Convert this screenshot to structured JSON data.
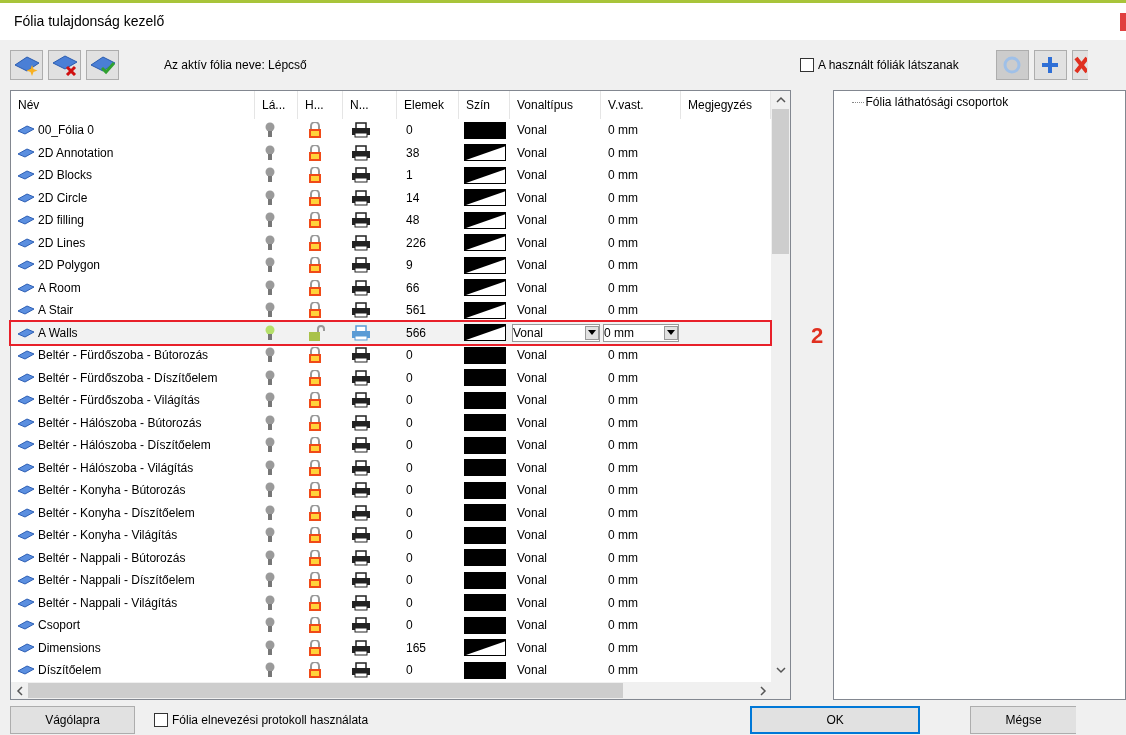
{
  "window": {
    "title": "Fólia tulajdonság kezelő"
  },
  "toolbar": {
    "active_layer_label": "Az aktív fólia neve: Lépcső"
  },
  "table": {
    "columns": [
      "Név",
      "Lá...",
      "H...",
      "N...",
      "Elemek",
      "Szín",
      "Vonaltípus",
      "V.vast.",
      "Megjegyzés"
    ],
    "rows": [
      {
        "name": "00_Fólia 0",
        "elements": "0",
        "kind": "solid",
        "linetype": "Vonal",
        "width": "0 mm",
        "selected": false
      },
      {
        "name": "2D Annotation",
        "elements": "38",
        "kind": "gradient",
        "linetype": "Vonal",
        "width": "0 mm",
        "selected": false
      },
      {
        "name": "2D Blocks",
        "elements": "1",
        "kind": "gradient",
        "linetype": "Vonal",
        "width": "0 mm",
        "selected": false
      },
      {
        "name": "2D Circle",
        "elements": "14",
        "kind": "gradient",
        "linetype": "Vonal",
        "width": "0 mm",
        "selected": false
      },
      {
        "name": "2D filling",
        "elements": "48",
        "kind": "gradient",
        "linetype": "Vonal",
        "width": "0 mm",
        "selected": false
      },
      {
        "name": "2D Lines",
        "elements": "226",
        "kind": "gradient",
        "linetype": "Vonal",
        "width": "0 mm",
        "selected": false
      },
      {
        "name": "2D Polygon",
        "elements": "9",
        "kind": "gradient",
        "linetype": "Vonal",
        "width": "0 mm",
        "selected": false
      },
      {
        "name": "A Room",
        "elements": "66",
        "kind": "gradient",
        "linetype": "Vonal",
        "width": "0 mm",
        "selected": false
      },
      {
        "name": "A Stair",
        "elements": "561",
        "kind": "gradient",
        "linetype": "Vonal",
        "width": "0 mm",
        "selected": false
      },
      {
        "name": "A Walls",
        "elements": "566",
        "kind": "gradient",
        "linetype": "Vonal",
        "width": "0 mm",
        "selected": true
      },
      {
        "name": "Beltér - Fürdőszoba - Bútorozás",
        "elements": "0",
        "kind": "solid",
        "linetype": "Vonal",
        "width": "0 mm",
        "selected": false
      },
      {
        "name": "Beltér - Fürdőszoba - Díszítőelem",
        "elements": "0",
        "kind": "solid",
        "linetype": "Vonal",
        "width": "0 mm",
        "selected": false
      },
      {
        "name": "Beltér - Fürdőszoba - Világítás",
        "elements": "0",
        "kind": "solid",
        "linetype": "Vonal",
        "width": "0 mm",
        "selected": false
      },
      {
        "name": "Beltér - Hálószoba - Bútorozás",
        "elements": "0",
        "kind": "solid",
        "linetype": "Vonal",
        "width": "0 mm",
        "selected": false
      },
      {
        "name": "Beltér - Hálószoba - Díszítőelem",
        "elements": "0",
        "kind": "solid",
        "linetype": "Vonal",
        "width": "0 mm",
        "selected": false
      },
      {
        "name": "Beltér - Hálószoba - Világítás",
        "elements": "0",
        "kind": "solid",
        "linetype": "Vonal",
        "width": "0 mm",
        "selected": false
      },
      {
        "name": "Beltér - Konyha - Bútorozás",
        "elements": "0",
        "kind": "solid",
        "linetype": "Vonal",
        "width": "0 mm",
        "selected": false
      },
      {
        "name": "Beltér - Konyha - Díszítőelem",
        "elements": "0",
        "kind": "solid",
        "linetype": "Vonal",
        "width": "0 mm",
        "selected": false
      },
      {
        "name": "Beltér - Konyha - Világítás",
        "elements": "0",
        "kind": "solid",
        "linetype": "Vonal",
        "width": "0 mm",
        "selected": false
      },
      {
        "name": "Beltér - Nappali - Bútorozás",
        "elements": "0",
        "kind": "solid",
        "linetype": "Vonal",
        "width": "0 mm",
        "selected": false
      },
      {
        "name": "Beltér - Nappali - Díszítőelem",
        "elements": "0",
        "kind": "solid",
        "linetype": "Vonal",
        "width": "0 mm",
        "selected": false
      },
      {
        "name": "Beltér - Nappali - Világítás",
        "elements": "0",
        "kind": "solid",
        "linetype": "Vonal",
        "width": "0 mm",
        "selected": false
      },
      {
        "name": "Csoport",
        "elements": "0",
        "kind": "solid",
        "linetype": "Vonal",
        "width": "0 mm",
        "selected": false
      },
      {
        "name": "Dimensions",
        "elements": "165",
        "kind": "gradient",
        "linetype": "Vonal",
        "width": "0 mm",
        "selected": false
      },
      {
        "name": "Díszítőelem",
        "elements": "0",
        "kind": "solid",
        "linetype": "Vonal",
        "width": "0 mm",
        "selected": false
      }
    ]
  },
  "annotation": "2",
  "right_panel": {
    "show_used_checkbox": {
      "label": "A használt fóliák látszanak",
      "checked": false
    },
    "tree_root": "Fólia láthatósági csoportok"
  },
  "footer": {
    "clipboard_button": "Vágólapra",
    "protocol_checkbox": {
      "label": "Fólia elnevezési protokoll használata",
      "checked": false
    },
    "ok_button": "OK",
    "cancel_button": "Mégse"
  }
}
